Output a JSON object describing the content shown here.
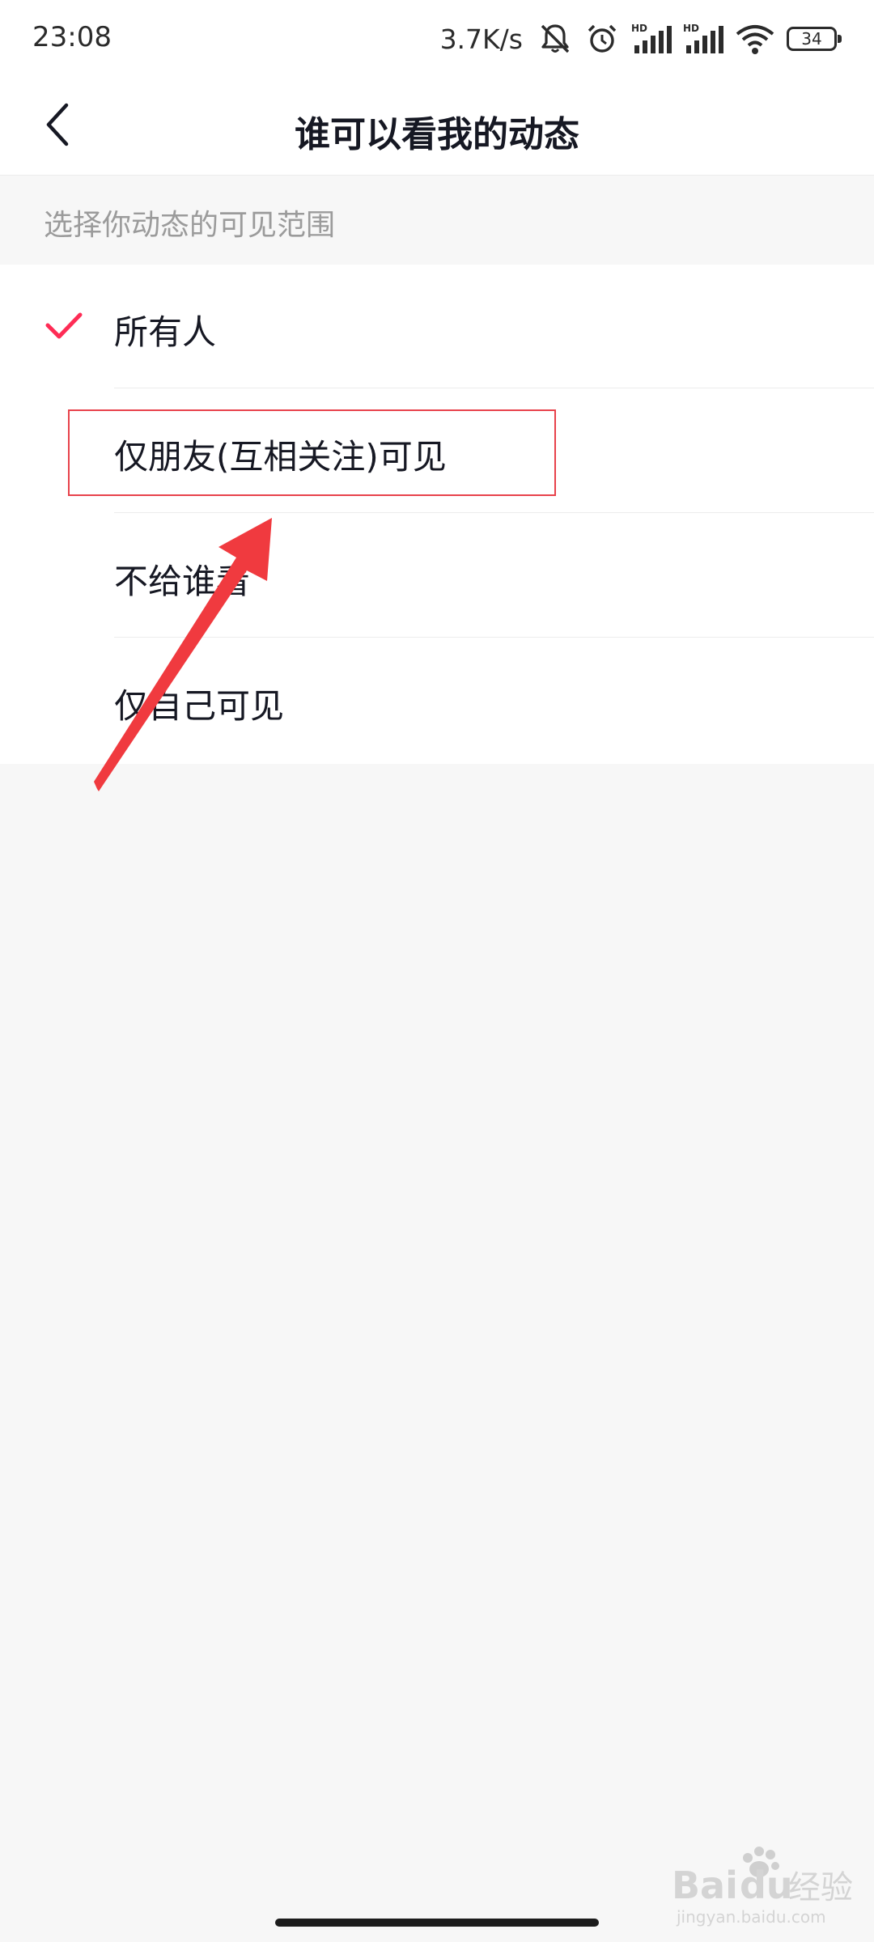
{
  "status_bar": {
    "time": "23:08",
    "net_speed": "3.7K/s",
    "battery": "34",
    "icons": [
      "bell-muted-icon",
      "alarm-icon",
      "signal-hd-icon",
      "signal-hd-icon",
      "wifi-icon",
      "battery-icon"
    ]
  },
  "nav": {
    "title": "谁可以看我的动态",
    "back_icon": "chevron-left-icon"
  },
  "section": {
    "header": "选择你动态的可见范围"
  },
  "options": [
    {
      "label": "所有人",
      "selected": true
    },
    {
      "label": "仅朋友(互相关注)可见",
      "selected": false
    },
    {
      "label": "不给谁看",
      "selected": false
    },
    {
      "label": "仅自己可见",
      "selected": false
    }
  ],
  "colors": {
    "accent": "#fe2c55",
    "annotation": "#f03a3f",
    "page_bg": "#f7f7f7",
    "header_text": "#9b9b9b"
  },
  "watermark": {
    "brand": "Bai",
    "brand2": "du",
    "label": "经验",
    "url": "jingyan.baidu.com"
  }
}
